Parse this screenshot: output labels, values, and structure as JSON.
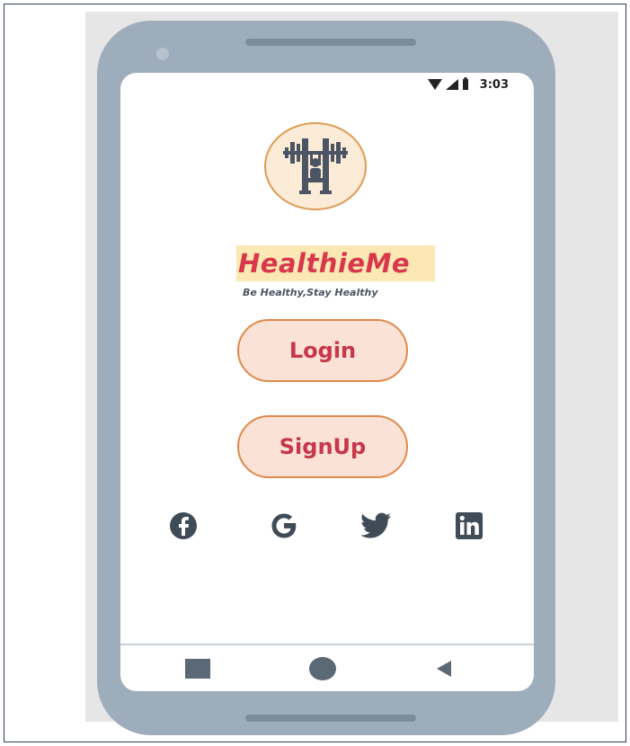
{
  "status_bar": {
    "time": "3:03",
    "icons": [
      "wifi-icon",
      "cell-signal-icon",
      "battery-icon"
    ]
  },
  "app": {
    "name": "HealthieMe",
    "tagline": "Be Healthy,Stay Healthy",
    "logo_icon": "weightlifter-logo-icon"
  },
  "buttons": {
    "login": "Login",
    "signup": "SignUp"
  },
  "social": [
    {
      "name": "facebook-icon"
    },
    {
      "name": "google-icon"
    },
    {
      "name": "twitter-icon"
    },
    {
      "name": "linkedin-icon"
    }
  ],
  "nav": {
    "icons": [
      "recent-apps-square-icon",
      "home-circle-icon",
      "back-triangle-icon"
    ]
  },
  "colors": {
    "brand_red": "#d9374b",
    "button_fill": "#fbe2d6",
    "button_border": "#e0894a",
    "phone_body": "#9eadbb",
    "icon_dark": "#404b58"
  }
}
